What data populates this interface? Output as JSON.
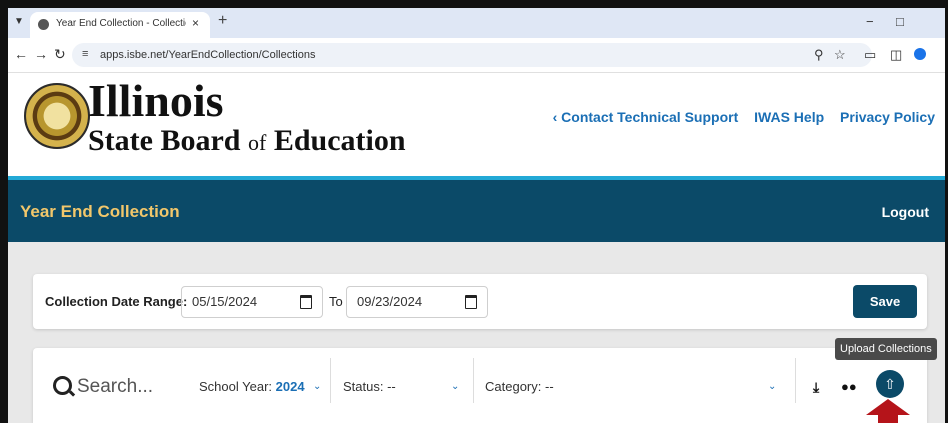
{
  "browser": {
    "tab_title": "Year End Collection - Collection",
    "tab_close": "×",
    "new_tab": "+",
    "url": "apps.isbe.net/YearEndCollection/Collections",
    "minimize": "−",
    "maximize": "□"
  },
  "header": {
    "logo_title": "Illinois",
    "logo_sub_1": "State Board",
    "logo_sub_of": "of",
    "logo_sub_2": "Education",
    "links": [
      {
        "label": "‹ Contact Technical Support"
      },
      {
        "label": "IWAS Help"
      },
      {
        "label": "Privacy Policy"
      }
    ]
  },
  "app_bar": {
    "title": "Year End Collection",
    "logout": "Logout"
  },
  "date_range": {
    "label": "Collection Date Range:",
    "start": "05/15/2024",
    "to_label": "To",
    "end": "09/23/2024",
    "save": "Save"
  },
  "tooltip": "Upload Collections",
  "filters": {
    "search_placeholder": "Search...",
    "school_year_label": "School Year:",
    "school_year_value": "2024",
    "status_label": "Status:",
    "status_value": "--",
    "category_label": "Category:",
    "category_value": "--"
  },
  "icons": [
    "download-icon",
    "users-icon",
    "upload-icon",
    "search-icon",
    "calendar-icon"
  ],
  "colors": {
    "brand_dark": "#0b4a68",
    "accent_gold": "#f2c76b",
    "link_blue": "#1b6fb5",
    "callout_red": "#b5141a"
  }
}
